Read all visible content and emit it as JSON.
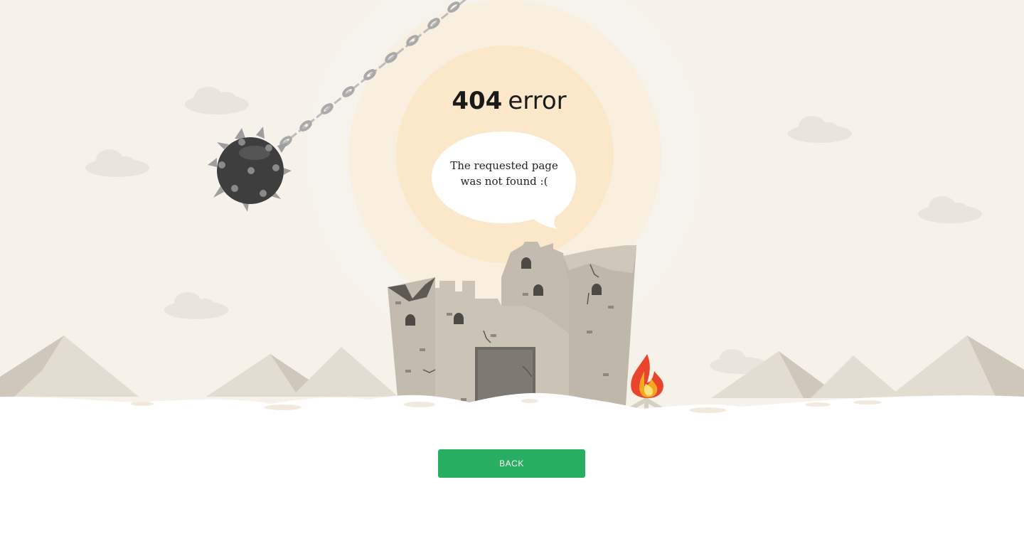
{
  "error": {
    "code": "404",
    "word": "error",
    "message_line1": "The requested page",
    "message_line2": "was not found :("
  },
  "actions": {
    "back_label": "BACK"
  },
  "colors": {
    "background_sky": "#f6f2ea",
    "sun_glow": "#faebd2",
    "button": "#27ae60",
    "ground": "#ffffff"
  }
}
